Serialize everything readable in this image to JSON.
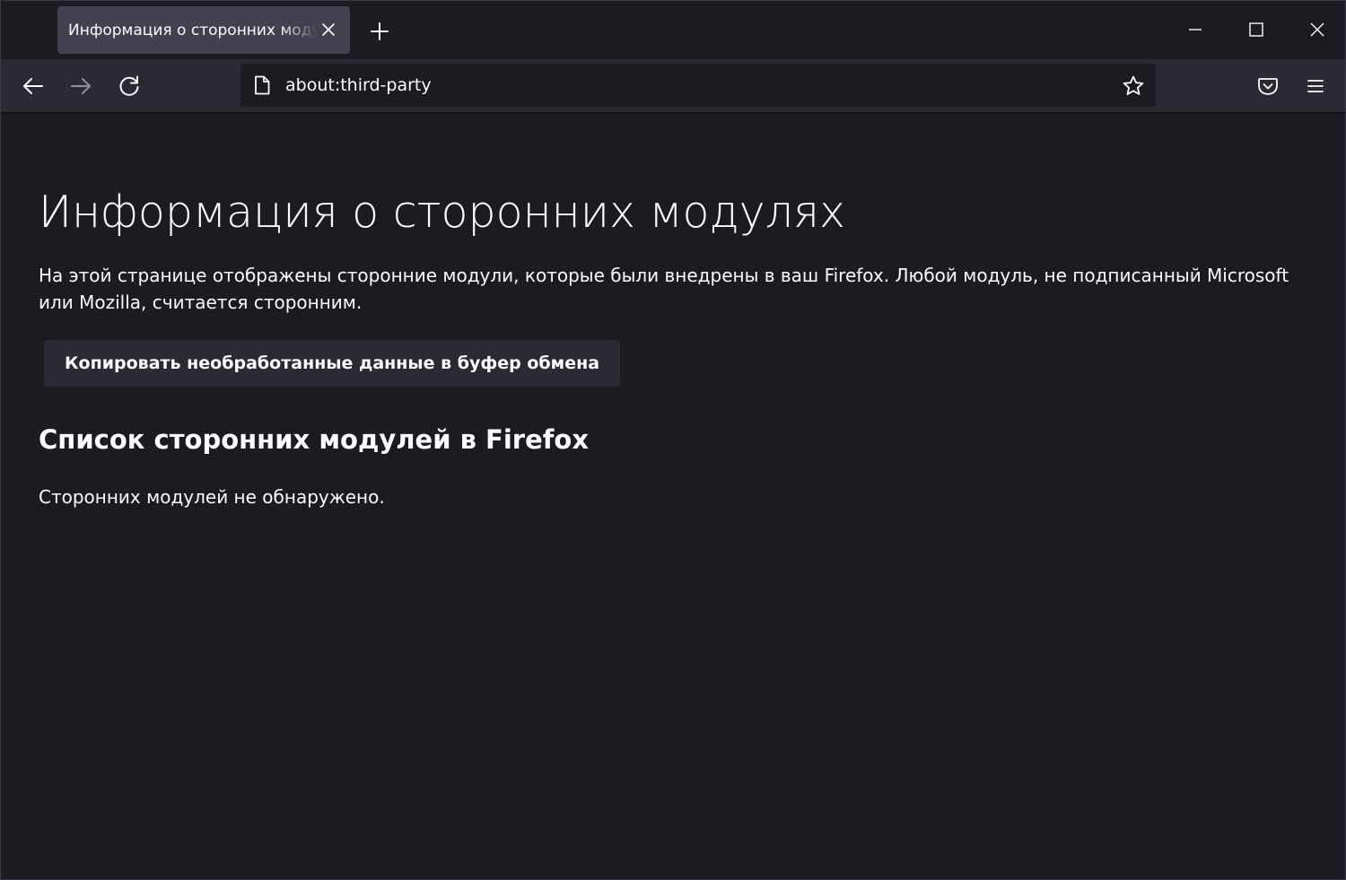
{
  "tab": {
    "title": "Информация о сторонних модулях",
    "close_icon": "close-icon"
  },
  "tabstrip": {
    "new_tab_icon": "plus-icon"
  },
  "window_controls": [
    "minimize-icon",
    "maximize-icon",
    "close-icon"
  ],
  "toolbar": {
    "back_icon": "arrow-left-icon",
    "forward_icon": "arrow-right-icon",
    "reload_icon": "reload-icon",
    "pocket_icon": "pocket-icon",
    "menu_icon": "hamburger-menu-icon"
  },
  "urlbar": {
    "page_icon": "page-icon",
    "url": "about:third-party",
    "bookmark_icon": "star-icon"
  },
  "page": {
    "title": "Информация о сторонних модулях",
    "intro": "На этой странице отображены сторонние модули, которые были внедрены в ваш Firefox. Любой модуль, не подписанный Microsoft или Mozilla, считается сторонним.",
    "copy_button": "Копировать необработанные данные в буфер обмена",
    "section_title": "Список сторонних модулей в Firefox",
    "empty_message": "Сторонних модулей не обнаружено."
  },
  "colors": {
    "background": "#1c1b22",
    "toolbar": "#2b2a33",
    "selected_tab": "#42414d",
    "text": "#fbfbfe"
  }
}
